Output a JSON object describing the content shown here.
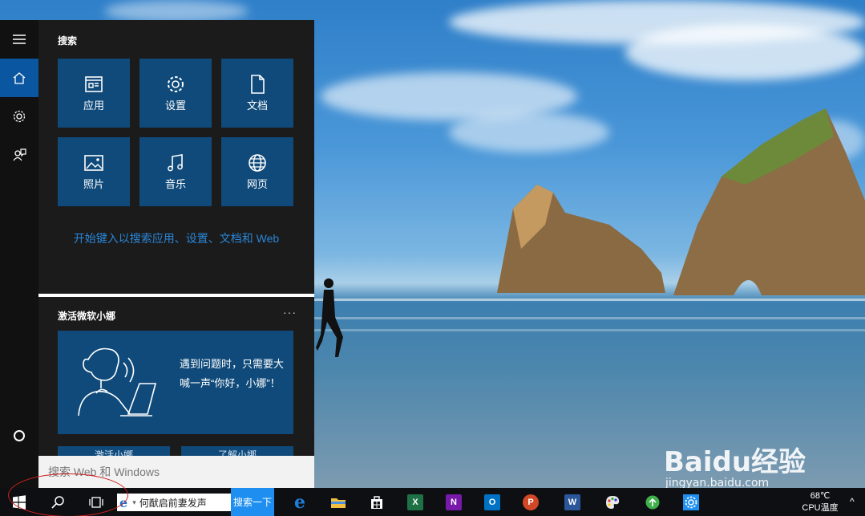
{
  "panel": {
    "search_section_title": "搜索",
    "tiles": [
      {
        "label": "应用",
        "icon": "app-window-icon"
      },
      {
        "label": "设置",
        "icon": "gear-icon"
      },
      {
        "label": "文档",
        "icon": "document-icon"
      },
      {
        "label": "照片",
        "icon": "photo-icon"
      },
      {
        "label": "音乐",
        "icon": "music-note-icon"
      },
      {
        "label": "网页",
        "icon": "globe-icon"
      }
    ],
    "hint": "开始键入以搜索应用、设置、文档和 Web",
    "cortana_section_title": "激活微软小娜",
    "more_label": "···",
    "card_text": "遇到问题时，只需要大喊一声“你好，小娜”！",
    "card_buttons": [
      "激活小娜",
      "了解小娜"
    ],
    "search_placeholder": "搜索 Web 和 Windows"
  },
  "rail": {
    "items": [
      {
        "icon": "hamburger-menu-icon"
      },
      {
        "icon": "home-icon",
        "active": true
      },
      {
        "icon": "gear-icon"
      },
      {
        "icon": "feedback-icon"
      },
      {
        "icon": "cortana-circle-icon"
      }
    ]
  },
  "taskbar": {
    "ie_search_text": "何猷启前妻发声",
    "search_button": "搜索一下",
    "apps": [
      {
        "name": "edge",
        "icon": "edge-icon",
        "color": "#1e7fd8"
      },
      {
        "name": "file-explorer",
        "icon": "folder-icon",
        "color": "#f0c040"
      },
      {
        "name": "store",
        "icon": "store-icon",
        "color": "#ffffff"
      },
      {
        "name": "excel",
        "icon": "excel-icon",
        "color": "#1e7145",
        "letter": "X"
      },
      {
        "name": "onenote",
        "icon": "onenote-icon",
        "color": "#7719aa",
        "letter": "N"
      },
      {
        "name": "outlook",
        "icon": "outlook-icon",
        "color": "#0072c6",
        "letter": "O"
      },
      {
        "name": "powerpoint",
        "icon": "powerpoint-icon",
        "color": "#d24726",
        "letter": "P"
      },
      {
        "name": "word",
        "icon": "word-icon",
        "color": "#2b579a",
        "letter": "W"
      },
      {
        "name": "paint",
        "icon": "paint-palette-icon",
        "color": "#e8e8e8"
      },
      {
        "name": "app-green",
        "icon": "green-circle-app-icon",
        "color": "#3fb04a"
      },
      {
        "name": "settings",
        "icon": "gear-icon",
        "color": "#1e8ff0"
      }
    ],
    "temperature": "68℃",
    "cpu_label": "CPU温度",
    "tray_arrow": "^"
  },
  "watermark": {
    "brand": "Baidu经验",
    "url": "jingyan.baidu.com"
  },
  "accent_color": "#0f4a7a",
  "rail_active_color": "#0a56a0",
  "annotation_color": "#d12020"
}
